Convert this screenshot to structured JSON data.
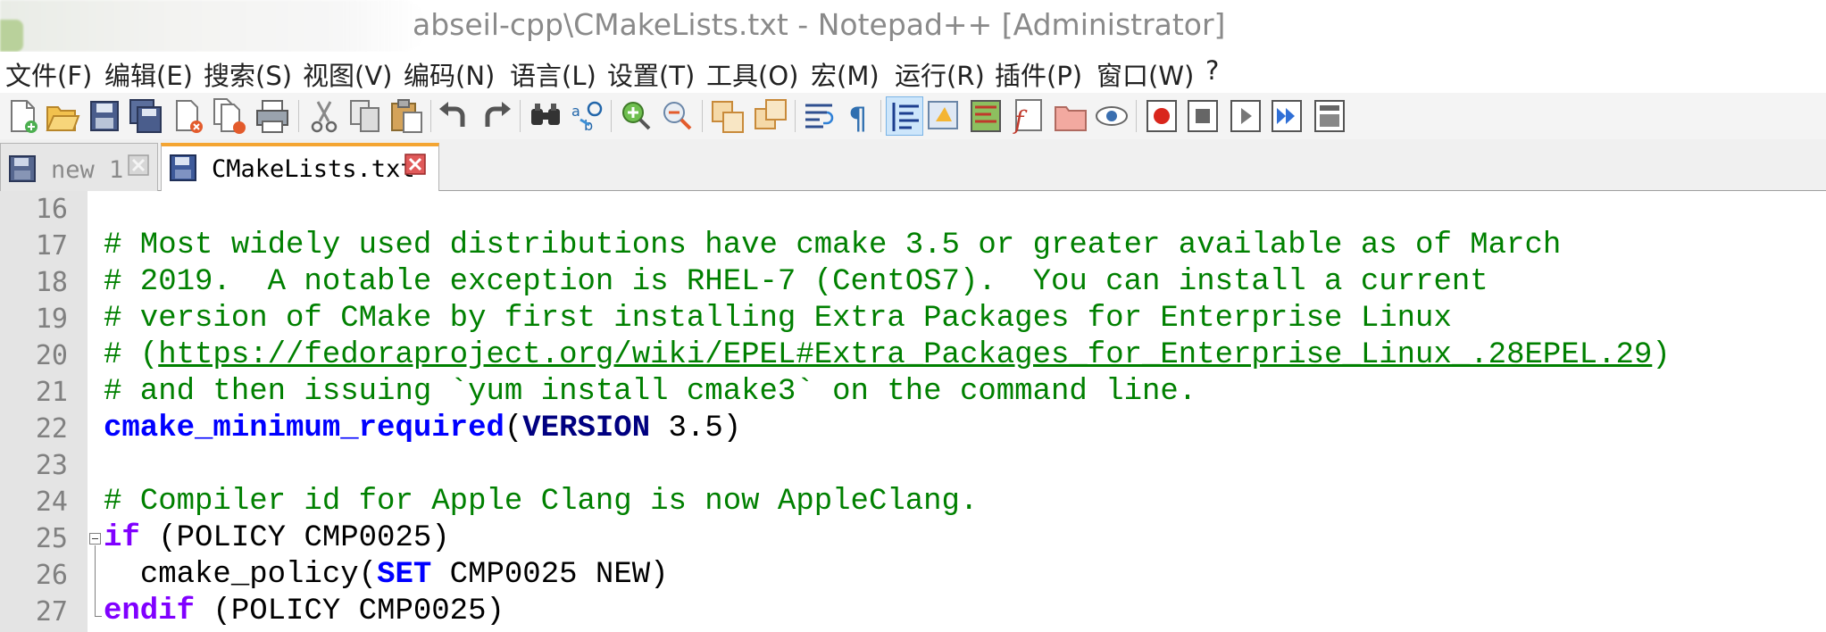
{
  "window": {
    "title": "abseil-cpp\\CMakeLists.txt - Notepad++ [Administrator]"
  },
  "menu": [
    {
      "label": "文件(F)"
    },
    {
      "label": "编辑(E)"
    },
    {
      "label": "搜索(S)"
    },
    {
      "label": "视图(V)"
    },
    {
      "label": "编码(N)"
    },
    {
      "label": "语言(L)"
    },
    {
      "label": "设置(T)"
    },
    {
      "label": "工具(O)"
    },
    {
      "label": "宏(M)"
    },
    {
      "label": "运行(R)"
    },
    {
      "label": "插件(P)"
    },
    {
      "label": "窗口(W)"
    },
    {
      "label": "?"
    }
  ],
  "toolbar": {
    "buttons": [
      "new-file-icon",
      "open-file-icon",
      "save-icon",
      "save-all-icon",
      "close-icon",
      "close-all-icon",
      "print-icon",
      "cut-icon",
      "copy-icon",
      "paste-icon",
      "undo-icon",
      "redo-icon",
      "find-icon",
      "replace-icon",
      "zoom-in-icon",
      "zoom-out-icon",
      "sync-vertical-icon",
      "sync-horizontal-icon",
      "word-wrap-icon",
      "show-all-characters-icon",
      "indent-guide-icon",
      "user-language-icon",
      "document-map-icon",
      "function-list-icon",
      "folder-workspace-icon",
      "monitoring-icon",
      "record-macro-icon",
      "stop-recording-icon",
      "playback-macro-icon",
      "run-macro-multiple-icon",
      "save-macro-icon"
    ]
  },
  "tabs": [
    {
      "label": "new 1",
      "active": false,
      "icon": "floppy-disk-icon",
      "close_icon": "close-tab-icon"
    },
    {
      "label": "CMakeLists.txt",
      "active": true,
      "icon": "floppy-disk-icon",
      "close_icon": "close-tab-icon"
    }
  ],
  "editor": {
    "lines": [
      {
        "number": "16",
        "text": ""
      },
      {
        "number": "17",
        "text": "# Most widely used distributions have cmake 3.5 or greater available as of March"
      },
      {
        "number": "18",
        "text": "# 2019.  A notable exception is RHEL-7 (CentOS7).  You can install a current"
      },
      {
        "number": "19",
        "text": "# version of CMake by first installing Extra Packages for Enterprise Linux"
      },
      {
        "number": "20",
        "text_prefix": "# (",
        "url": "https://fedoraproject.org/wiki/EPEL#Extra_Packages_for_Enterprise_Linux_.28EPEL.29",
        "text_suffix": ")"
      },
      {
        "number": "21",
        "text": "# and then issuing `yum install cmake3` on the command line."
      },
      {
        "number": "22",
        "cmd": "cmake_minimum_required",
        "open": "(",
        "kw": "VERSION",
        "rest": " 3.5)"
      },
      {
        "number": "23",
        "text": ""
      },
      {
        "number": "24",
        "text": "# Compiler id for Apple Clang is now AppleClang."
      },
      {
        "number": "25",
        "kw": "if",
        "rest": " (POLICY CMP0025)"
      },
      {
        "number": "26",
        "indent": "  ",
        "cmd": "cmake_policy(",
        "kw": "SET",
        "rest": " CMP0025 NEW)"
      },
      {
        "number": "27",
        "kw": "endif",
        "rest": " (POLICY CMP0025)"
      }
    ]
  },
  "colors": {
    "comment": "#008000",
    "keyword": "#0000ff",
    "control_keyword": "#8000ff",
    "line_number": "#808080",
    "active_tab_accent": "#f4a532"
  }
}
